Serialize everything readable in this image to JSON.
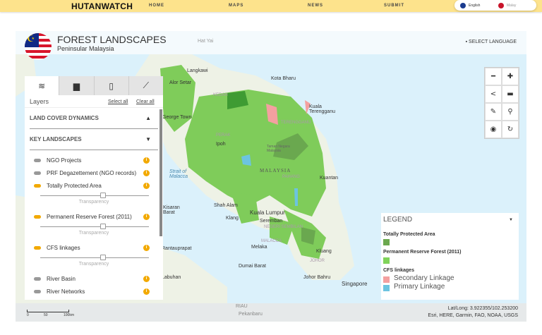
{
  "nav": {
    "brand": "HUTANWATCH",
    "links": [
      "HOME",
      "MAPS",
      "NEWS",
      "SUBMIT"
    ],
    "languages": [
      "English",
      "Malay"
    ]
  },
  "header": {
    "title": "FOREST LANDSCAPES",
    "subtitle": "Peninsular Malaysia",
    "select_language": "SELECT LANGUAGE"
  },
  "map": {
    "labels": [
      "Hat Yai",
      "Langkawi",
      "Alor Setar",
      "KEDAH",
      "George Town",
      "PERAK",
      "Ipoh",
      "Kota Bharu",
      "Kuala Terengganu",
      "TERENGGANU",
      "Taman Negara Malaysia",
      "MALAYSIA",
      "PAHANG",
      "Kuantan",
      "Strait of Malacca",
      "Shah Alam",
      "Kuala Lumpur",
      "Klang",
      "Seremban",
      "NEGERI SEMBILAN",
      "MALACCA",
      "Melaka",
      "Kluang",
      "JOHOR",
      "Johor Bahru",
      "Singapore",
      "Dumai Barat",
      "RIAU",
      "Pekanbaru",
      "Kisaran Barat",
      "Rantauprapat",
      "Labuhan"
    ]
  },
  "panel": {
    "tabs": [
      "layers-icon",
      "comment-icon",
      "ruler-icon",
      "chart-icon"
    ],
    "heading": "Layers",
    "select_all": "Select all",
    "clear_all": "Clear all",
    "sections": [
      {
        "title": "LAND COVER DYNAMICS",
        "caret": "▲"
      },
      {
        "title": "KEY LANDSCAPES",
        "caret": "▼"
      }
    ],
    "layers": [
      {
        "name": "NGO Projects",
        "on": false
      },
      {
        "name": "PRF Degazettement (NGO records)",
        "on": false
      },
      {
        "name": "Totally Protected Area",
        "on": true,
        "slider": "Transparency"
      },
      {
        "name": "Permanent Reserve Forest (2011)",
        "on": true,
        "slider": "Transparency"
      },
      {
        "name": "CFS linkages",
        "on": true,
        "slider": "Transparency"
      },
      {
        "name": "River Basin",
        "on": false
      },
      {
        "name": "River Networks",
        "on": false
      }
    ]
  },
  "tools": [
    "minus-icon",
    "plus-icon",
    "share-icon",
    "print-icon",
    "draw-icon",
    "search-icon",
    "eye-icon",
    "refresh-icon"
  ],
  "legend": {
    "title": "LEGEND",
    "groups": [
      {
        "title": "Totally Protected Area",
        "color": "#6aa84f"
      },
      {
        "title": "Permanent Reserve Forest (2011)",
        "color": "#7fd35a"
      },
      {
        "title": "CFS linkages"
      }
    ],
    "items": [
      {
        "label": "Secondary Linkage",
        "color": "#f4a0a0"
      },
      {
        "label": "Primary Linkage",
        "color": "#6cc4e0"
      }
    ]
  },
  "footer": {
    "latlong": "Lat/Long: 3.922355/102.253200",
    "attribution": "Esri, HERE, Garmin, FAO, NOAA, USGS",
    "scale": [
      "0",
      "50",
      "100km"
    ]
  }
}
